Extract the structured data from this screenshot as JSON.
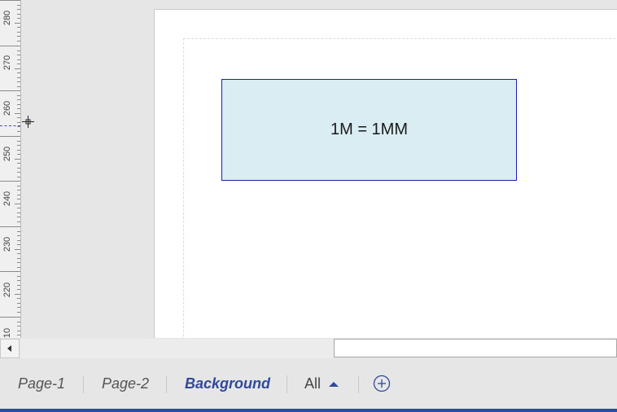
{
  "ruler": {
    "labels": [
      "280",
      "270",
      "260",
      "250",
      "240",
      "230",
      "220",
      "10"
    ]
  },
  "shape": {
    "text": "1M = 1MM"
  },
  "tabs": [
    {
      "label": "Page-1"
    },
    {
      "label": "Page-2"
    },
    {
      "label": "Background",
      "active": true
    }
  ],
  "all_menu": {
    "label": "All"
  },
  "colors": {
    "accent": "#2f4a9a",
    "shape_fill": "#daedf2",
    "shape_border": "#1d1db8"
  },
  "icons": {
    "scroll_left": "scroll-left-icon",
    "add_page": "plus-circle-icon",
    "all_caret": "caret-up-icon",
    "pointer": "crosshair-icon"
  }
}
